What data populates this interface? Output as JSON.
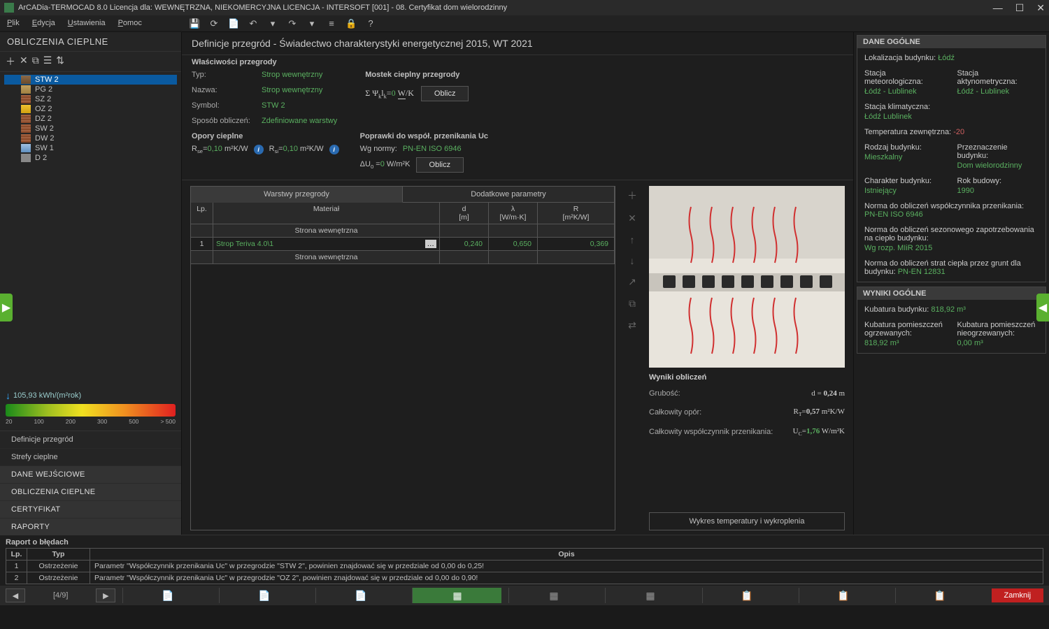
{
  "window": {
    "title": "ArCADia-TERMOCAD 8.0 Licencja dla: WEWNĘTRZNA, NIEKOMERCYJNA LICENCJA - INTERSOFT [001] - 08. Certyfikat dom wielorodzinny"
  },
  "menu": {
    "file": "Plik",
    "edit": "Edycja",
    "settings": "Ustawienia",
    "help": "Pomoc"
  },
  "left": {
    "header": "OBLICZENIA CIEPLNE",
    "tree": [
      {
        "label": "STW 2",
        "sel": true,
        "icon": "t1"
      },
      {
        "label": "PG 2",
        "icon": "t2"
      },
      {
        "label": "SZ 2",
        "icon": "t3"
      },
      {
        "label": "OZ 2",
        "icon": "t4"
      },
      {
        "label": "DZ 2",
        "icon": "t3"
      },
      {
        "label": "SW 2",
        "icon": "t3"
      },
      {
        "label": "DW 2",
        "icon": "t3"
      },
      {
        "label": "SW 1",
        "icon": "t5"
      },
      {
        "label": "D 2",
        "icon": "t6"
      }
    ],
    "energy_value": "105,93 kWh/(m²rok)",
    "scale": [
      "20",
      "100",
      "200",
      "300",
      "500",
      "> 500"
    ],
    "nav": [
      {
        "label": "Definicje przegród",
        "emph": false
      },
      {
        "label": "Strefy cieplne",
        "emph": false
      },
      {
        "label": "DANE WEJŚCIOWE",
        "emph": true
      },
      {
        "label": "OBLICZENIA CIEPLNE",
        "emph": true
      },
      {
        "label": "CERTYFIKAT",
        "emph": true
      },
      {
        "label": "RAPORTY",
        "emph": true
      }
    ]
  },
  "center": {
    "title": "Definicje przegród - Świadectwo charakterystyki energetycznej 2015, WT 2021",
    "props_header": "Właściwości przegrody",
    "typ_lbl": "Typ:",
    "typ_val": "Strop wewnętrzny",
    "nazwa_lbl": "Nazwa:",
    "nazwa_val": "Strop wewnętrzny",
    "symbol_lbl": "Symbol:",
    "symbol_val": "STW 2",
    "sposob_lbl": "Sposób obliczeń:",
    "sposob_val": "Zdefiniowane warstwy",
    "mostek_header": "Mostek cieplny przegrody",
    "mostek_formula": "Σ Ψₖlₖ=0  W/K",
    "oblicz": "Oblicz",
    "opory_header": "Opory cieplne",
    "rse": "Rₛₑ=0,10 m²K/W",
    "rsi": "Rₛᵢ=0,10 m²K/W",
    "poprawki_header": "Poprawki do współ. przenikania Uc",
    "wg_normy_lbl": "Wg normy:",
    "wg_normy_val": "PN-EN ISO 6946",
    "du": "ΔU₀ =0 W/m²K",
    "tabs": {
      "layers": "Warstwy przegrody",
      "extra": "Dodatkowe parametry"
    },
    "thead": {
      "lp": "Lp.",
      "mat": "Materiał",
      "d": "d [m]",
      "l": "λ [W/m·K]",
      "r": "R [m²K/W]"
    },
    "rows_header_inner": "Strona wewnętrzna",
    "row1": {
      "lp": "1",
      "mat": "Strop Teriva 4.0\\1",
      "d": "0,240",
      "l": "0,650",
      "r": "0,369"
    },
    "rows_footer_inner": "Strona wewnętrzna",
    "wyniki_title": "Wyniki obliczeń",
    "grubosc_lbl": "Grubość:",
    "grubosc_f": "d = ",
    "grubosc_v": "0,24",
    "grubosc_u": " m",
    "opor_lbl": "Całkowity opór:",
    "opor_f": "Rₜ=",
    "opor_v": "0,57",
    "opor_u": " m²K/W",
    "uc_lbl": "Całkowity współczynnik przenikania:",
    "uc_f": "U_C=",
    "uc_v": "1,76",
    "uc_u": " W/m²K",
    "chart_btn": "Wykres temperatury i wykroplenia"
  },
  "right": {
    "sec1_header": "DANE OGÓLNE",
    "lokal_lbl": "Lokalizacja budynku:",
    "lokal_val": "Łódź",
    "stacja_met_lbl": "Stacja meteorologiczna:",
    "stacja_met_val": "Łódź - Lublinek",
    "stacja_akt_lbl": "Stacja aktynometryczna:",
    "stacja_akt_val": "Łódź - Lublinek",
    "stacja_klim_lbl": "Stacja klimatyczna:",
    "stacja_klim_val": "Łódź Lublinek",
    "temp_lbl": "Temperatura zewnętrzna:",
    "temp_val": "-20",
    "rodzaj_lbl": "Rodzaj budynku:",
    "rodzaj_val": "Mieszkalny",
    "przez_lbl": "Przeznaczenie budynku:",
    "przez_val": "Dom wielorodzinny",
    "char_lbl": "Charakter budynku:",
    "char_val": "Istniejący",
    "rok_lbl": "Rok budowy:",
    "rok_val": "1990",
    "norma1_lbl": "Norma do obliczeń współczynnika przenikania:",
    "norma1_val": "PN-EN ISO 6946",
    "norma2_lbl": "Norma do obliczeń sezonowego zapotrzebowania na ciepło budynku:",
    "norma2_val": "Wg rozp. MIiR 2015",
    "norma3_lbl": "Norma do obliczeń strat ciepła przez grunt dla budynku:",
    "norma3_val": "PN-EN 12831",
    "sec2_header": "WYNIKI OGÓLNE",
    "kub_lbl": "Kubatura budynku:",
    "kub_val": "818,92 m³",
    "kub_ogrz_lbl": "Kubatura pomieszczeń ogrzewanych:",
    "kub_ogrz_val": "818,92 m³",
    "kub_nogrz_lbl": "Kubatura pomieszczeń nieogrzewanych:",
    "kub_nogrz_val": "0,00 m³"
  },
  "errors": {
    "title": "Raport o błędach",
    "headers": {
      "lp": "Lp.",
      "typ": "Typ",
      "opis": "Opis"
    },
    "rows": [
      {
        "lp": "1",
        "typ": "Ostrzeżenie",
        "opis": "Parametr \"Współczynnik przenikania Uc\" w przegrodzie \"STW 2\", powinien znajdować się w przedziale od 0,00 do 0,25!"
      },
      {
        "lp": "2",
        "typ": "Ostrzeżenie",
        "opis": "Parametr \"Współczynnik przenikania Uc\" w przegrodzie \"OZ 2\", powinien znajdować się w przedziale od 0,00 do 0,90!"
      }
    ]
  },
  "pager": {
    "page": "[4/9]",
    "close": "Zamknij"
  }
}
